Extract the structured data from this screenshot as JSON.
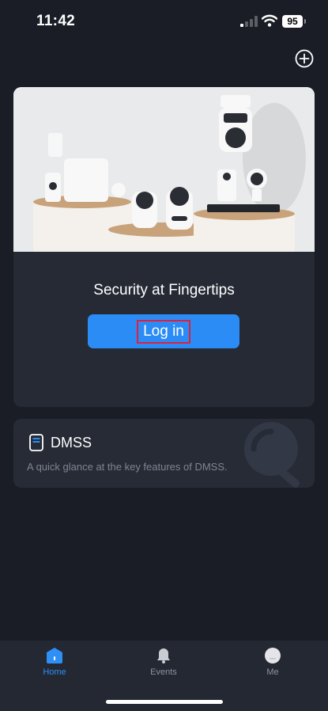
{
  "status_bar": {
    "time": "11:42",
    "battery": "95"
  },
  "hero": {
    "title": "Security at Fingertips",
    "login_label": "Log in"
  },
  "dmss_card": {
    "title": "DMSS",
    "description": "A quick glance at the key features of DMSS."
  },
  "tabs": [
    {
      "label": "Home",
      "icon": "home-icon",
      "active": true
    },
    {
      "label": "Events",
      "icon": "bell-icon",
      "active": false
    },
    {
      "label": "Me",
      "icon": "profile-icon",
      "active": false
    }
  ],
  "colors": {
    "background": "#1a1d25",
    "card": "#252a35",
    "accent": "#2b8cf6",
    "highlight_border": "#e0203a"
  }
}
